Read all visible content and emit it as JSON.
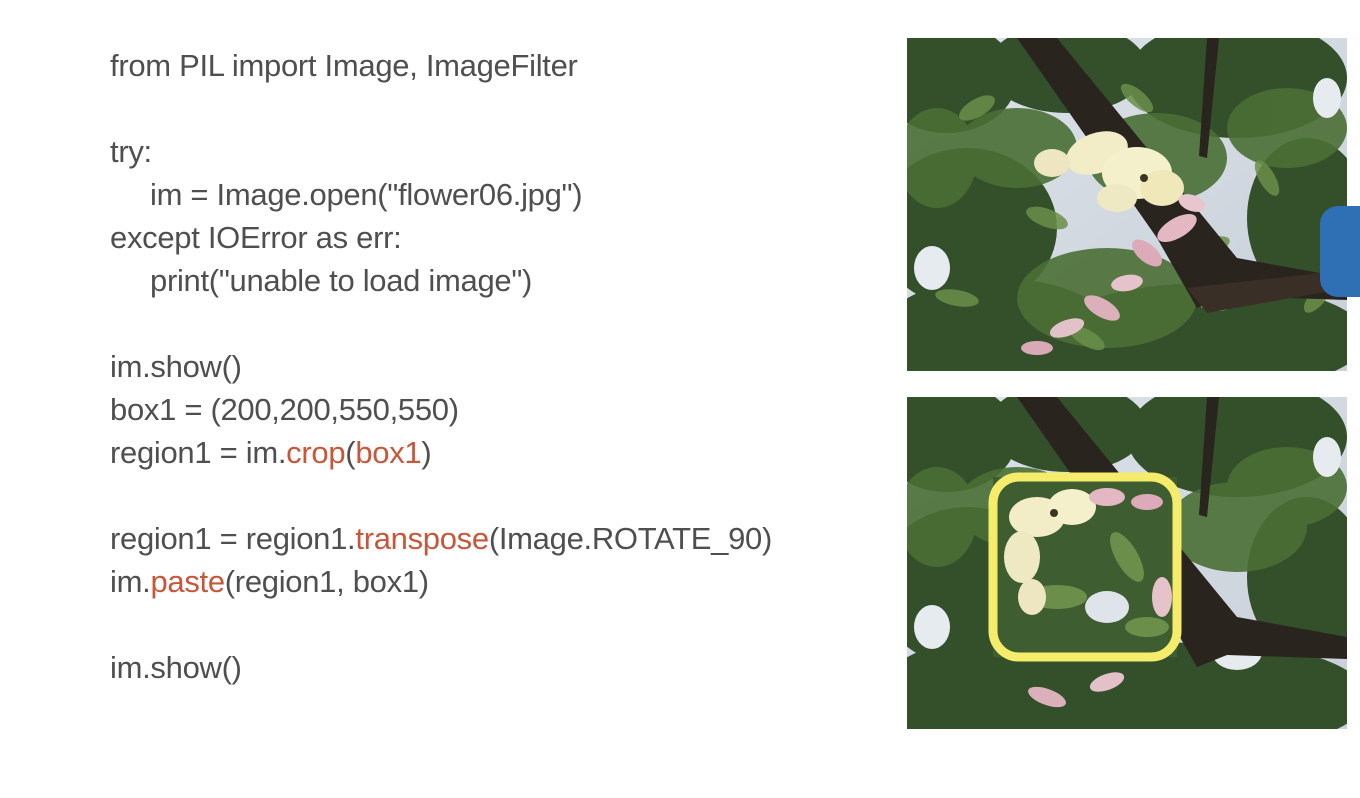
{
  "code": {
    "line1": "from PIL import Image, ImageFilter",
    "line2": "try:",
    "line3": "im = Image.open(\"flower06.jpg\")",
    "line4": "except IOError as err:",
    "line5": "print(\"unable to load image\")",
    "line6": "im.show()",
    "line7": "box1 = (200,200,550,550)",
    "line8_a": "region1 = im.",
    "line8_b": "crop",
    "line8_c": "(",
    "line8_d": "box1",
    "line8_e": ")",
    "line9_a": "region1 = region1.",
    "line9_b": "transpose",
    "line9_c": "(Image.ROTATE_90)",
    "line10_a": "im.",
    "line10_b": "paste",
    "line10_c": "(region1, box1)",
    "line11": "im.show()"
  },
  "colors": {
    "code_text": "#4f4f4f",
    "code_highlight": "#c8563a",
    "highlight_box": "#f4ec6a",
    "side_tab": "#2f6fb3"
  },
  "images": {
    "top": "flower-photo-original",
    "bottom": "flower-photo-rotated-region"
  }
}
